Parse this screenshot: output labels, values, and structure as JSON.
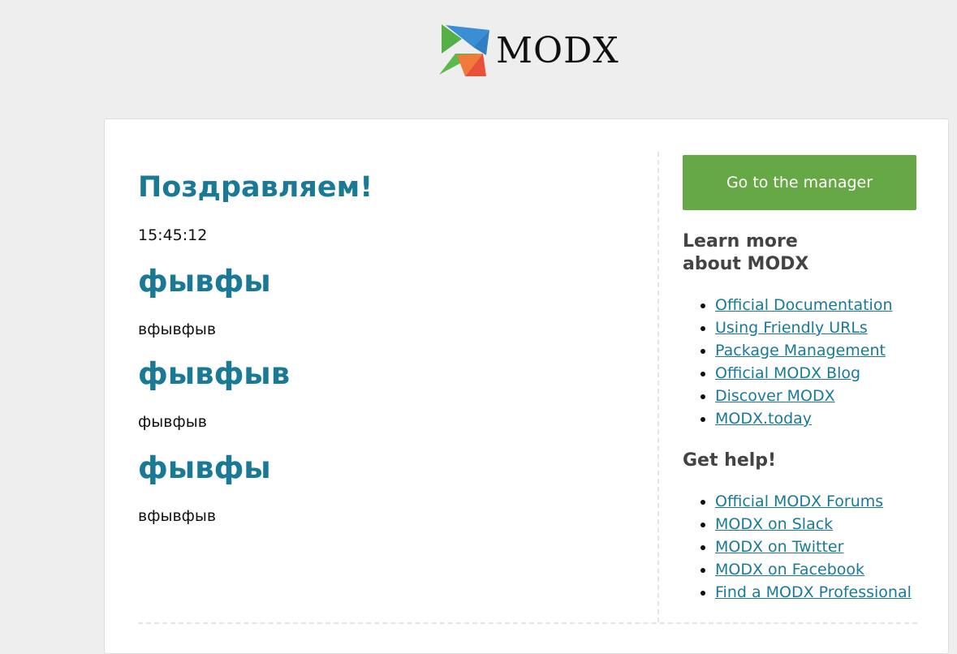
{
  "logo": {
    "text": "MODX"
  },
  "main": {
    "title": "Поздравляем!",
    "time": "15:45:12",
    "sections": [
      {
        "heading": "фывфы",
        "text": "вфывфыв"
      },
      {
        "heading": "фывфыв",
        "text": "фывфыв"
      },
      {
        "heading": "фывфы",
        "text": "вфывфыв"
      }
    ]
  },
  "sidebar": {
    "manager_button": "Go to the manager",
    "learn_heading": "Learn more about MODX",
    "learn_links": [
      "Official Documentation",
      "Using Friendly URLs",
      "Package Management",
      "Official MODX Blog",
      "Discover MODX",
      "MODX.today"
    ],
    "help_heading": "Get help!",
    "help_links": [
      "Official MODX Forums",
      "MODX on Slack",
      "MODX on Twitter",
      "MODX on Facebook",
      "Find a MODX Professional"
    ]
  },
  "colors": {
    "accent": "#1a7a96",
    "button": "#67a846",
    "background": "#eeeeee"
  }
}
